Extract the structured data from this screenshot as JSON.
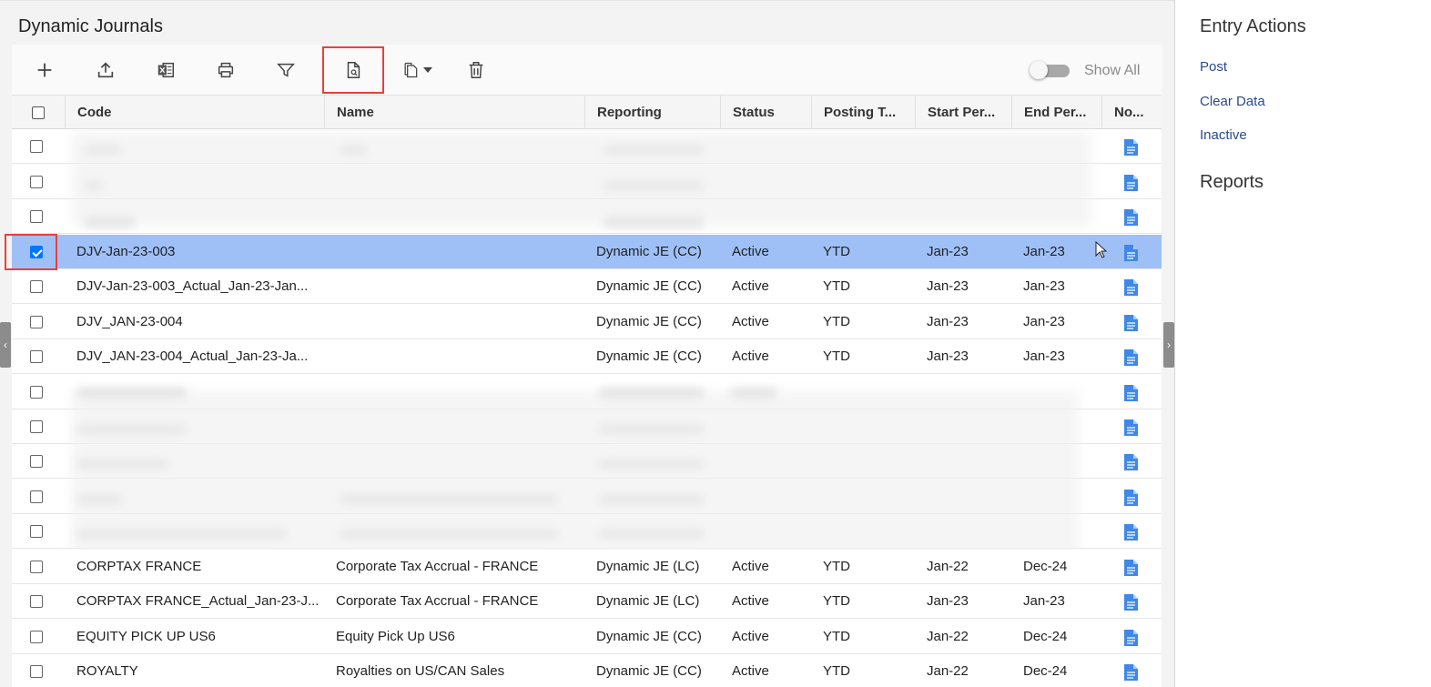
{
  "page": {
    "title": "Dynamic Journals"
  },
  "toolbar": {
    "show_all_label": "Show All",
    "buttons": [
      "plus-icon",
      "upload-icon",
      "excel-icon",
      "print-icon",
      "filter-icon",
      "document-search-icon",
      "copy-icon",
      "delete-icon"
    ]
  },
  "grid": {
    "columns": [
      "Code",
      "Name",
      "Reporting",
      "Status",
      "Posting T...",
      "Start Per...",
      "End Per...",
      "No..."
    ],
    "rows": [
      {
        "code": "DJV-Jan-23-003",
        "name": "",
        "reporting": "Dynamic JE (CC)",
        "status": "Active",
        "posting": "YTD",
        "start": "Jan-23",
        "end": "Jan-23",
        "selected": true
      },
      {
        "code": "DJV-Jan-23-003_Actual_Jan-23-Jan...",
        "name": "",
        "reporting": "Dynamic JE (CC)",
        "status": "Active",
        "posting": "YTD",
        "start": "Jan-23",
        "end": "Jan-23"
      },
      {
        "code": "DJV_JAN-23-004",
        "name": "",
        "reporting": "Dynamic JE (CC)",
        "status": "Active",
        "posting": "YTD",
        "start": "Jan-23",
        "end": "Jan-23"
      },
      {
        "code": "DJV_JAN-23-004_Actual_Jan-23-Ja...",
        "name": "",
        "reporting": "Dynamic JE (CC)",
        "status": "Active",
        "posting": "YTD",
        "start": "Jan-23",
        "end": "Jan-23"
      },
      {
        "code": "CORPTAX FRANCE",
        "name": "Corporate Tax Accrual - FRANCE",
        "reporting": "Dynamic JE (LC)",
        "status": "Active",
        "posting": "YTD",
        "start": "Jan-22",
        "end": "Dec-24"
      },
      {
        "code": "CORPTAX FRANCE_Actual_Jan-23-J...",
        "name": "Corporate Tax Accrual - FRANCE",
        "reporting": "Dynamic JE (LC)",
        "status": "Active",
        "posting": "YTD",
        "start": "Jan-23",
        "end": "Jan-23"
      },
      {
        "code": "EQUITY PICK UP US6",
        "name": "Equity Pick Up US6",
        "reporting": "Dynamic JE (CC)",
        "status": "Active",
        "posting": "YTD",
        "start": "Jan-22",
        "end": "Dec-24"
      },
      {
        "code": "ROYALTY",
        "name": "Royalties on US/CAN Sales",
        "reporting": "Dynamic JE (CC)",
        "status": "Active",
        "posting": "YTD",
        "start": "Jan-22",
        "end": "Dec-24"
      }
    ]
  },
  "right_panel": {
    "entry_actions_title": "Entry Actions",
    "actions": [
      "Post",
      "Clear Data",
      "Inactive"
    ],
    "reports_title": "Reports"
  },
  "colors": {
    "selected_row": "#9ec0f7",
    "link": "#2b4a8b",
    "highlight_box": "#e8403b"
  }
}
